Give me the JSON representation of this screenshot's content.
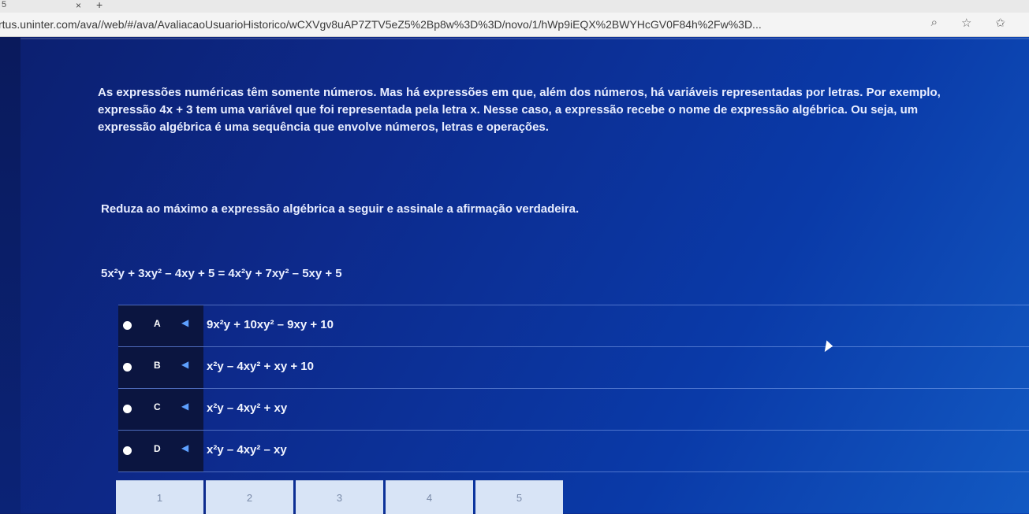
{
  "browser": {
    "tab_close": "×",
    "tab_new": "+",
    "tab_count": "5",
    "url": "rtus.uninter.com/ava//web/#/ava/AvaliacaoUsuarioHistorico/wCXVgv8uAP7ZTV5eZ5%2Bp8w%3D%3D/novo/1/hWp9iEQX%2BWYHcGV0F84h%2Fw%3D..."
  },
  "intro": {
    "line1": "As expressões numéricas têm somente números. Mas há expressões em que, além dos números, há variáveis representadas por letras. Por exemplo,",
    "line2": "expressão 4x + 3 tem uma variável que foi representada pela letra x. Nesse caso, a expressão recebe o nome de expressão algébrica. Ou seja, um",
    "line3": "expressão algébrica é uma sequência que envolve números, letras e operações."
  },
  "question": "Reduza ao máximo a expressão algébrica a seguir e assinale a afirmação verdadeira.",
  "expression": "5x²y + 3xy² – 4xy + 5 = 4x²y + 7xy² – 5xy + 5",
  "options": [
    {
      "letter": "A",
      "text": "9x²y + 10xy² – 9xy + 10"
    },
    {
      "letter": "B",
      "text": "x²y – 4xy² + xy + 10"
    },
    {
      "letter": "C",
      "text": "x²y – 4xy² + xy"
    },
    {
      "letter": "D",
      "text": "x²y – 4xy² – xy"
    }
  ],
  "pager": [
    "1",
    "2",
    "3",
    "4",
    "5"
  ]
}
